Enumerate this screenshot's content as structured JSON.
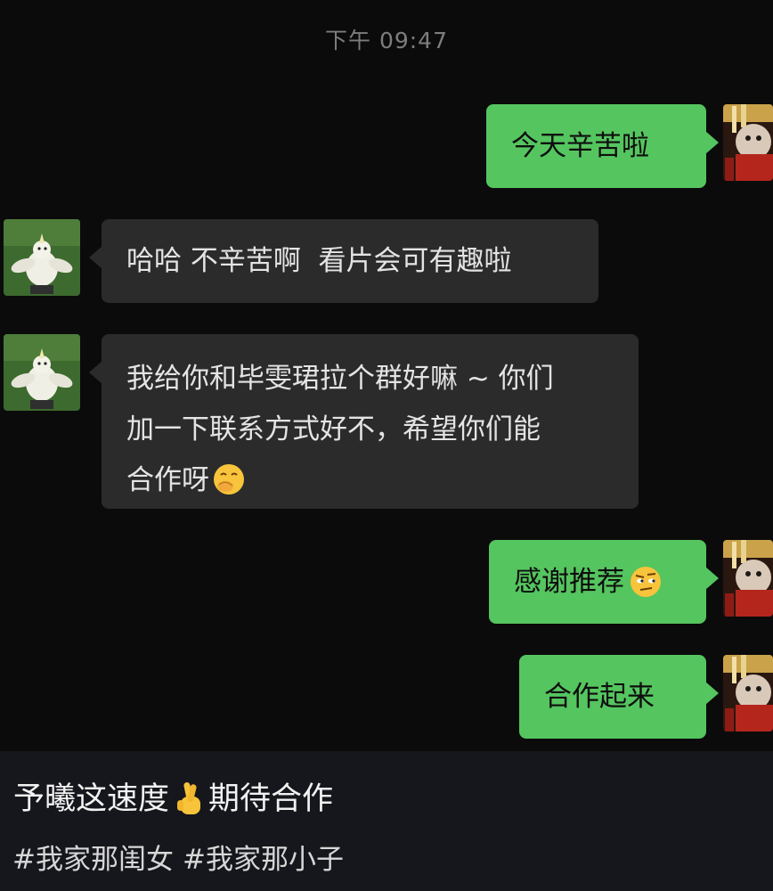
{
  "chat": {
    "timestamp": "下午 09:47",
    "messages": [
      {
        "side": "out",
        "text": "今天辛苦啦"
      },
      {
        "side": "in",
        "text": "哈哈 不辛苦啊  看片会可有趣啦"
      },
      {
        "side": "in",
        "lines": [
          "我给你和毕雯珺拉个群好嘛 ~ 你们",
          "加一下联系方式好不，希望你们能",
          "合作呀"
        ],
        "emoji": "hand-over-mouth-emoji"
      },
      {
        "side": "out",
        "text": "感谢推荐",
        "emoji": "raised-eyebrow-emoji"
      },
      {
        "side": "out",
        "text": "合作起来"
      }
    ]
  },
  "post": {
    "caption_text": "予曦这速度",
    "caption_emoji": "crossed-fingers-emoji",
    "caption_text_2": "期待合作",
    "hashtags": [
      "#我家那闺女",
      "#我家那小子"
    ]
  },
  "colors": {
    "outgoing_bubble": "#55c55f",
    "incoming_bubble": "#2b2b2b",
    "chat_background": "#0b0b0b",
    "caption_background": "#16171c"
  }
}
